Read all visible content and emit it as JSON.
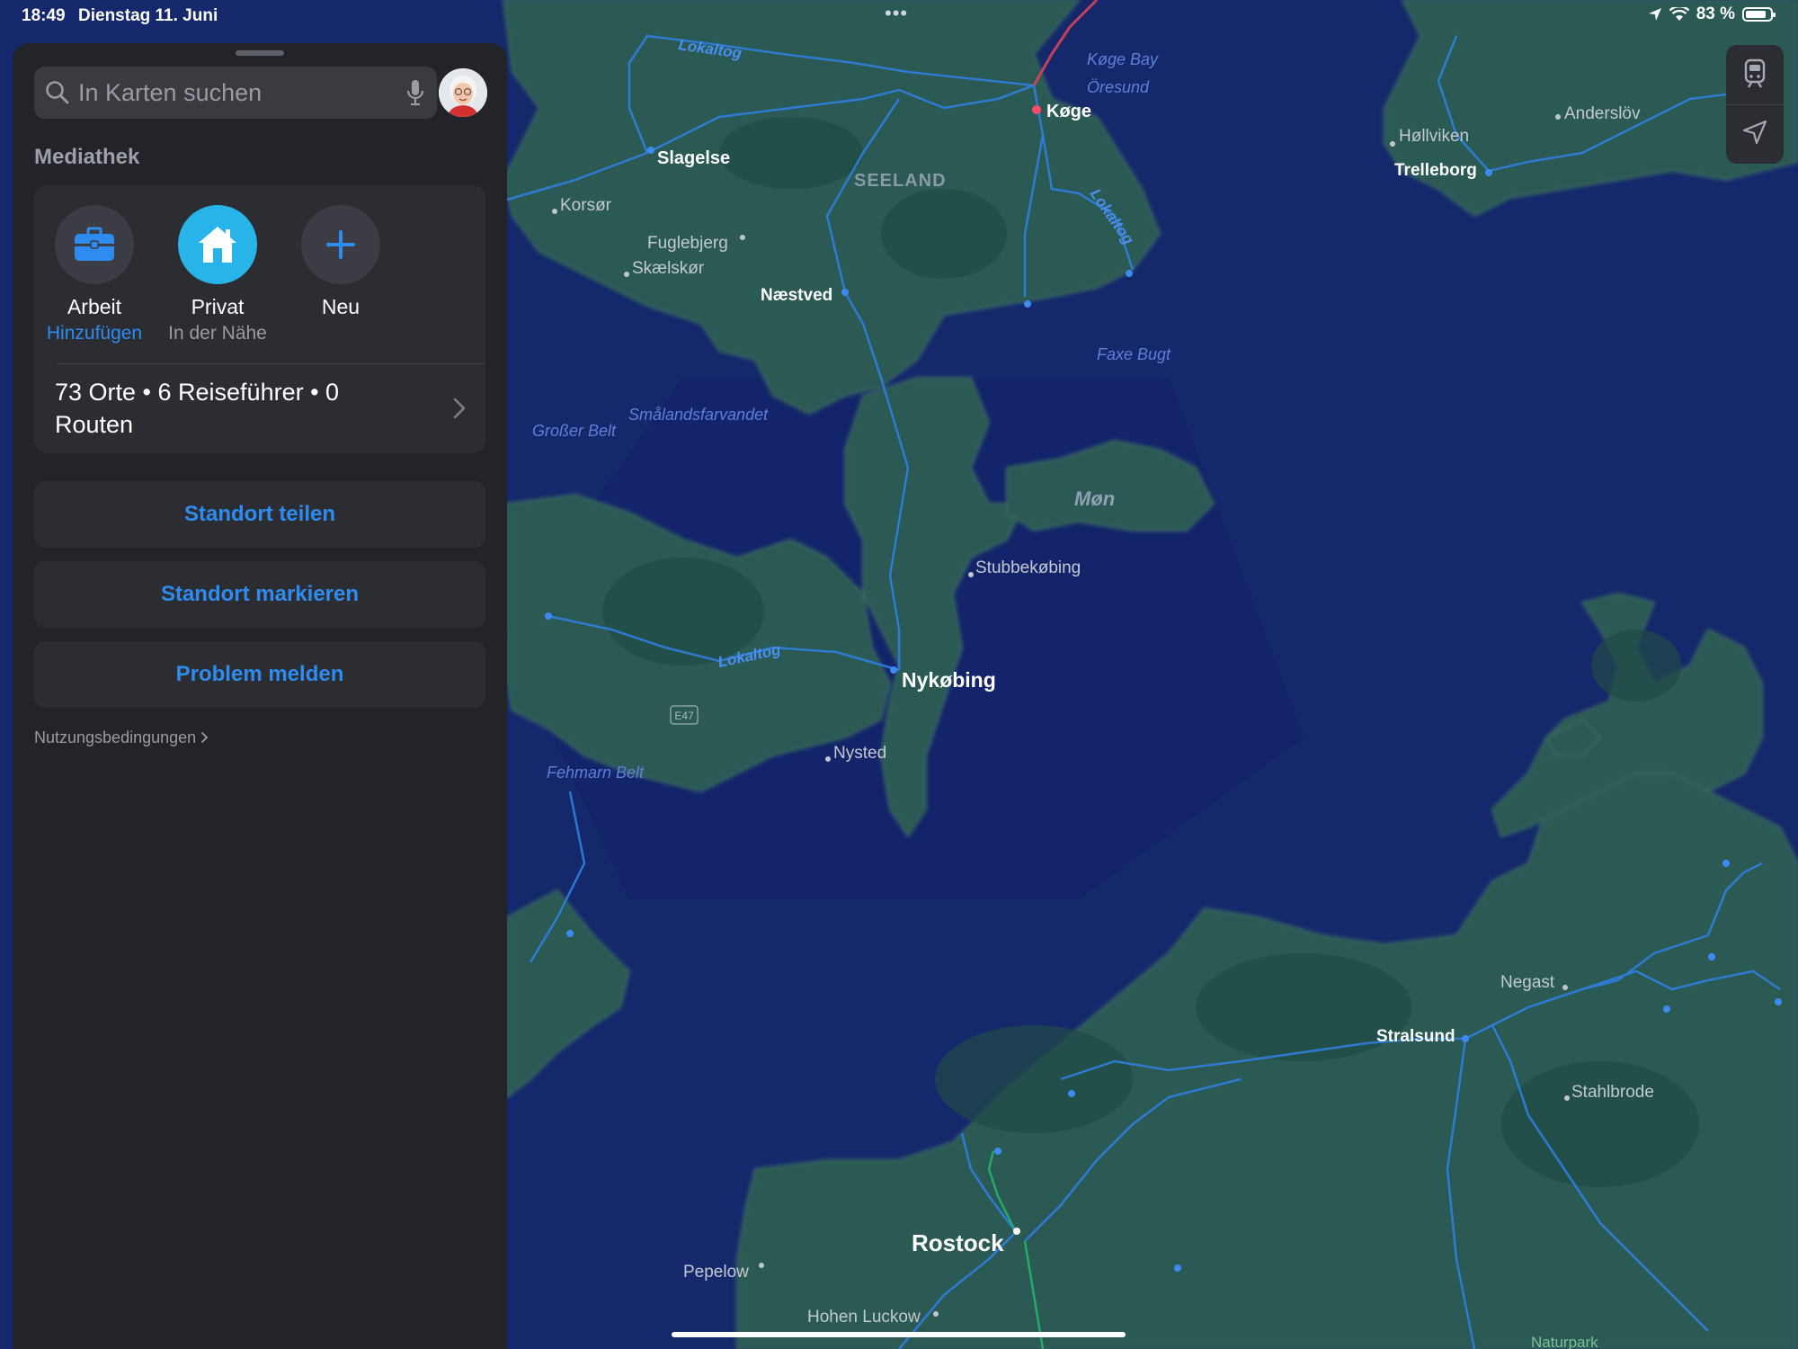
{
  "status_bar": {
    "time": "18:49",
    "date": "Dienstag 11. Juni",
    "battery": "83 %",
    "battery_level": 0.83
  },
  "sidebar": {
    "search_placeholder": "In Karten suchen",
    "library_title": "Mediathek",
    "favorites": [
      {
        "label": "Arbeit",
        "sub": "Hinzufügen",
        "icon": "briefcase-icon",
        "color": "#2e8cf0"
      },
      {
        "label": "Privat",
        "sub": "In der Nähe",
        "icon": "house-icon",
        "color": "#28b4e8"
      },
      {
        "label": "Neu",
        "sub": "",
        "icon": "plus-icon",
        "color": "#2e8cf0"
      }
    ],
    "stats": "73 Orte • 6 Reiseführer • 0 Routen",
    "buttons": {
      "share": "Standort teilen",
      "mark": "Standort markieren",
      "report": "Problem melden"
    },
    "terms": "Nutzungsbedingungen"
  },
  "map": {
    "places": [
      "Slagelse",
      "Køge",
      "SEELAND",
      "Korsør",
      "Fuglebjerg",
      "Skælskør",
      "Næstved",
      "Høllviken",
      "Anderslöv",
      "Trelleborg",
      "Stubbekøbing",
      "Nykøbing",
      "Nysted",
      "Negast",
      "Stralsund",
      "Stahlbrode",
      "Rostock",
      "Pepelow",
      "Hohen Luckow",
      "Naturpark"
    ],
    "islands": [
      "Møn"
    ],
    "waters": [
      "Køge Bay",
      "Öresund",
      "Faxe Bugt",
      "Smålandsfarvandet",
      "Großer Belt",
      "Fehmarn Belt"
    ],
    "rail_label": "Lokaltog",
    "road_shield": "E47",
    "colors": {
      "water": "#15286b",
      "land": "#2a5a52",
      "land_dark": "#1f4a46",
      "route": "#2f7fe0"
    }
  }
}
